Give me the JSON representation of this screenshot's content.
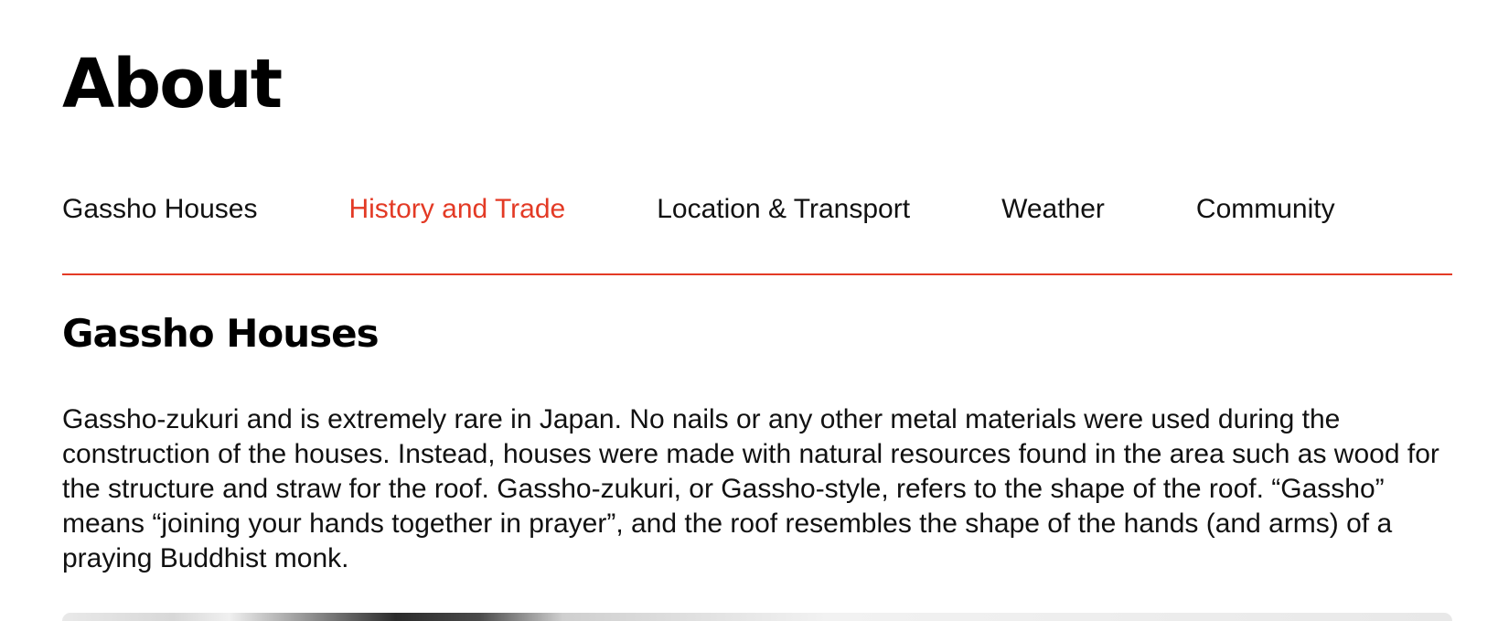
{
  "page": {
    "title": "About"
  },
  "tabs": [
    {
      "label": "Gassho Houses",
      "active": false
    },
    {
      "label": "History and Trade",
      "active": true
    },
    {
      "label": "Location & Transport",
      "active": false
    },
    {
      "label": "Weather",
      "active": false
    },
    {
      "label": "Community",
      "active": false
    }
  ],
  "colors": {
    "accent": "#e33a25",
    "text": "#111111",
    "background": "#ffffff"
  },
  "section": {
    "title": "Gassho Houses",
    "body": "Gassho-zukuri and is extremely rare in Japan. No nails or any other metal materials were used during the construction of the houses. Instead, houses were made with natural resources found in the area such as wood for the structure and straw for the roof. Gassho-zukuri, or Gassho-style, refers to the shape of the roof. “Gassho” means “joining your hands together in prayer”, and the roof resembles the shape of the hands (and arms) of a praying Buddhist monk."
  }
}
